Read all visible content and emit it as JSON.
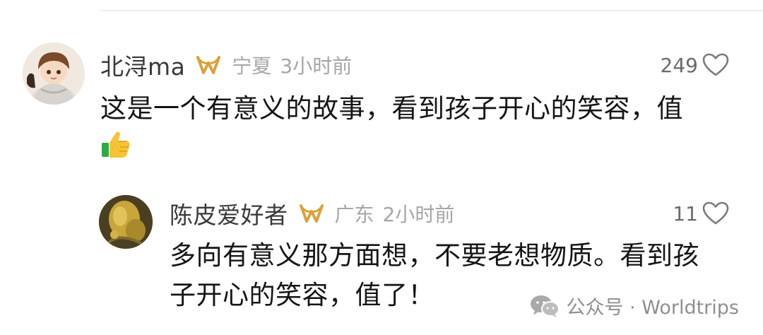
{
  "comments": [
    {
      "username": "北浔ma",
      "location": "宁夏",
      "time": "3小时前",
      "likes": "249",
      "text_line1": "这是一个有意义的故事，看到孩子开心的笑容，值",
      "emoji": "thumbs-up"
    },
    {
      "username": "陈皮爱好者",
      "location": "广东",
      "time": "2小时前",
      "likes": "11",
      "text_line1": "多向有意义那方面想，不要老想物质。看到孩",
      "text_line2": "子开心的笑容，值了！"
    }
  ],
  "watermark": {
    "text": "公众号 · Worldtrips"
  },
  "colors": {
    "badge_gold": "#d9a23a",
    "meta_gray": "#a6a6a6",
    "text": "#151515"
  }
}
